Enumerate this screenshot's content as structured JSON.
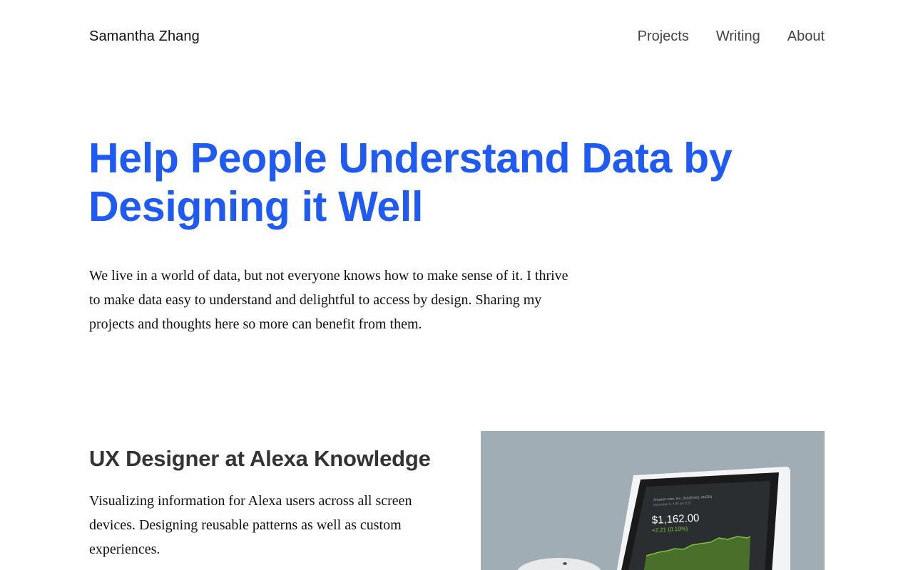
{
  "header": {
    "site_name": "Samantha Zhang",
    "nav": [
      {
        "label": "Projects"
      },
      {
        "label": "Writing"
      },
      {
        "label": "About"
      }
    ]
  },
  "hero": {
    "title": "Help People Understand Data by Designing it Well",
    "intro": "We live in a world of data, but not everyone knows how to make sense of it. I thrive to make data easy to understand and delightful to access by design. Sharing my projects and thoughts here so more can benefit from them."
  },
  "project": {
    "title": "UX Designer at Alexa Knowledge",
    "description": "Visualizing information for Alexa users across all screen devices. Designing reusable patterns as well as custom experiences.",
    "image": {
      "subject": "echo-show-device",
      "screen_header": "Amazon.com, Inc. (NASDAQ: AMZN)",
      "screen_subheader": "December 6, 4:00 pm EST",
      "price": "$1,162.00",
      "change": "+2.21 (0.19%)",
      "chart_color": "#7fc241"
    }
  },
  "colors": {
    "accent": "#1f5af2",
    "image_bg": "#a1adb5"
  }
}
